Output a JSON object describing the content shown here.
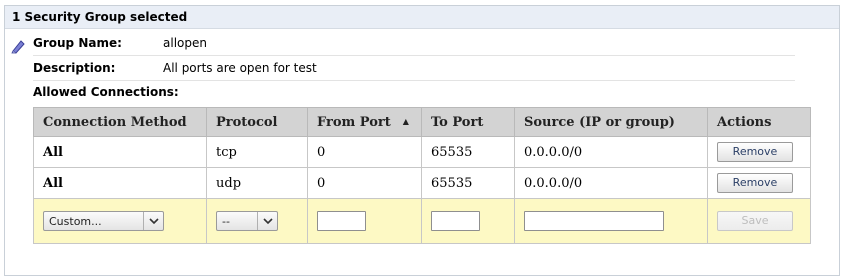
{
  "panel": {
    "title": "1 Security Group selected"
  },
  "group": {
    "name_label": "Group Name:",
    "name_value": "allopen",
    "description_label": "Description:",
    "description_value": "All ports are open for test",
    "connections_label": "Allowed Connections:"
  },
  "table": {
    "headers": {
      "method": "Connection Method",
      "protocol": "Protocol",
      "from_port": "From Port",
      "to_port": "To Port",
      "source": "Source (IP or group)",
      "actions": "Actions"
    },
    "sort_indicator": "▲",
    "rows": [
      {
        "method": "All",
        "protocol": "tcp",
        "from_port": "0",
        "to_port": "65535",
        "source": "0.0.0.0/0",
        "action": "Remove"
      },
      {
        "method": "All",
        "protocol": "udp",
        "from_port": "0",
        "to_port": "65535",
        "source": "0.0.0.0/0",
        "action": "Remove"
      }
    ],
    "new_rule": {
      "method_value": "Custom...",
      "protocol_value": "--",
      "from_port_value": "",
      "to_port_value": "",
      "source_value": "",
      "save_label": "Save"
    }
  },
  "colors": {
    "header_bg": "#e9eef6",
    "table_header_bg": "#d3d3d3",
    "new_rule_bg": "#fdf9c4",
    "button_text": "#2b3f66"
  }
}
